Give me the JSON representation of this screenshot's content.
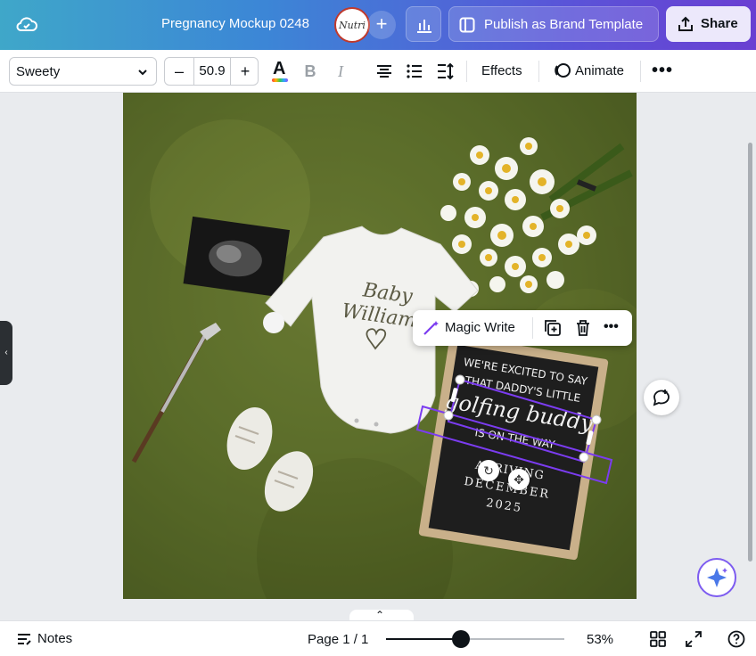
{
  "header": {
    "doc_title": "Pregnancy Mockup 0248",
    "avatar_text": "Nutri",
    "publish_label": "Publish as Brand Template",
    "share_label": "Share"
  },
  "toolbar": {
    "font_name": "Sweety",
    "font_size": "50.9",
    "minus": "–",
    "plus": "+",
    "bold": "B",
    "italic": "I",
    "effects_label": "Effects",
    "animate_label": "Animate"
  },
  "design": {
    "onesie_text_1": "Baby",
    "onesie_text_2": "Williams",
    "board_line_1": "WE'RE EXCITED TO SAY",
    "board_line_2": "THAT DADDY'S LITTLE",
    "board_line_3": "golfing buddy",
    "board_line_4": "IS ON THE WAY",
    "board_line_5": "ARRIVING",
    "board_line_6": "DECEMBER",
    "board_line_7": "2025"
  },
  "context_menu": {
    "magic_write_label": "Magic Write"
  },
  "footer": {
    "notes_label": "Notes",
    "page_indicator": "Page 1 / 1",
    "zoom_label": "53%",
    "zoom_fraction": 0.42,
    "expand_glyph": "⌃"
  },
  "colors": {
    "accent": "#8b3dff",
    "selection": "#7b3cf0"
  }
}
